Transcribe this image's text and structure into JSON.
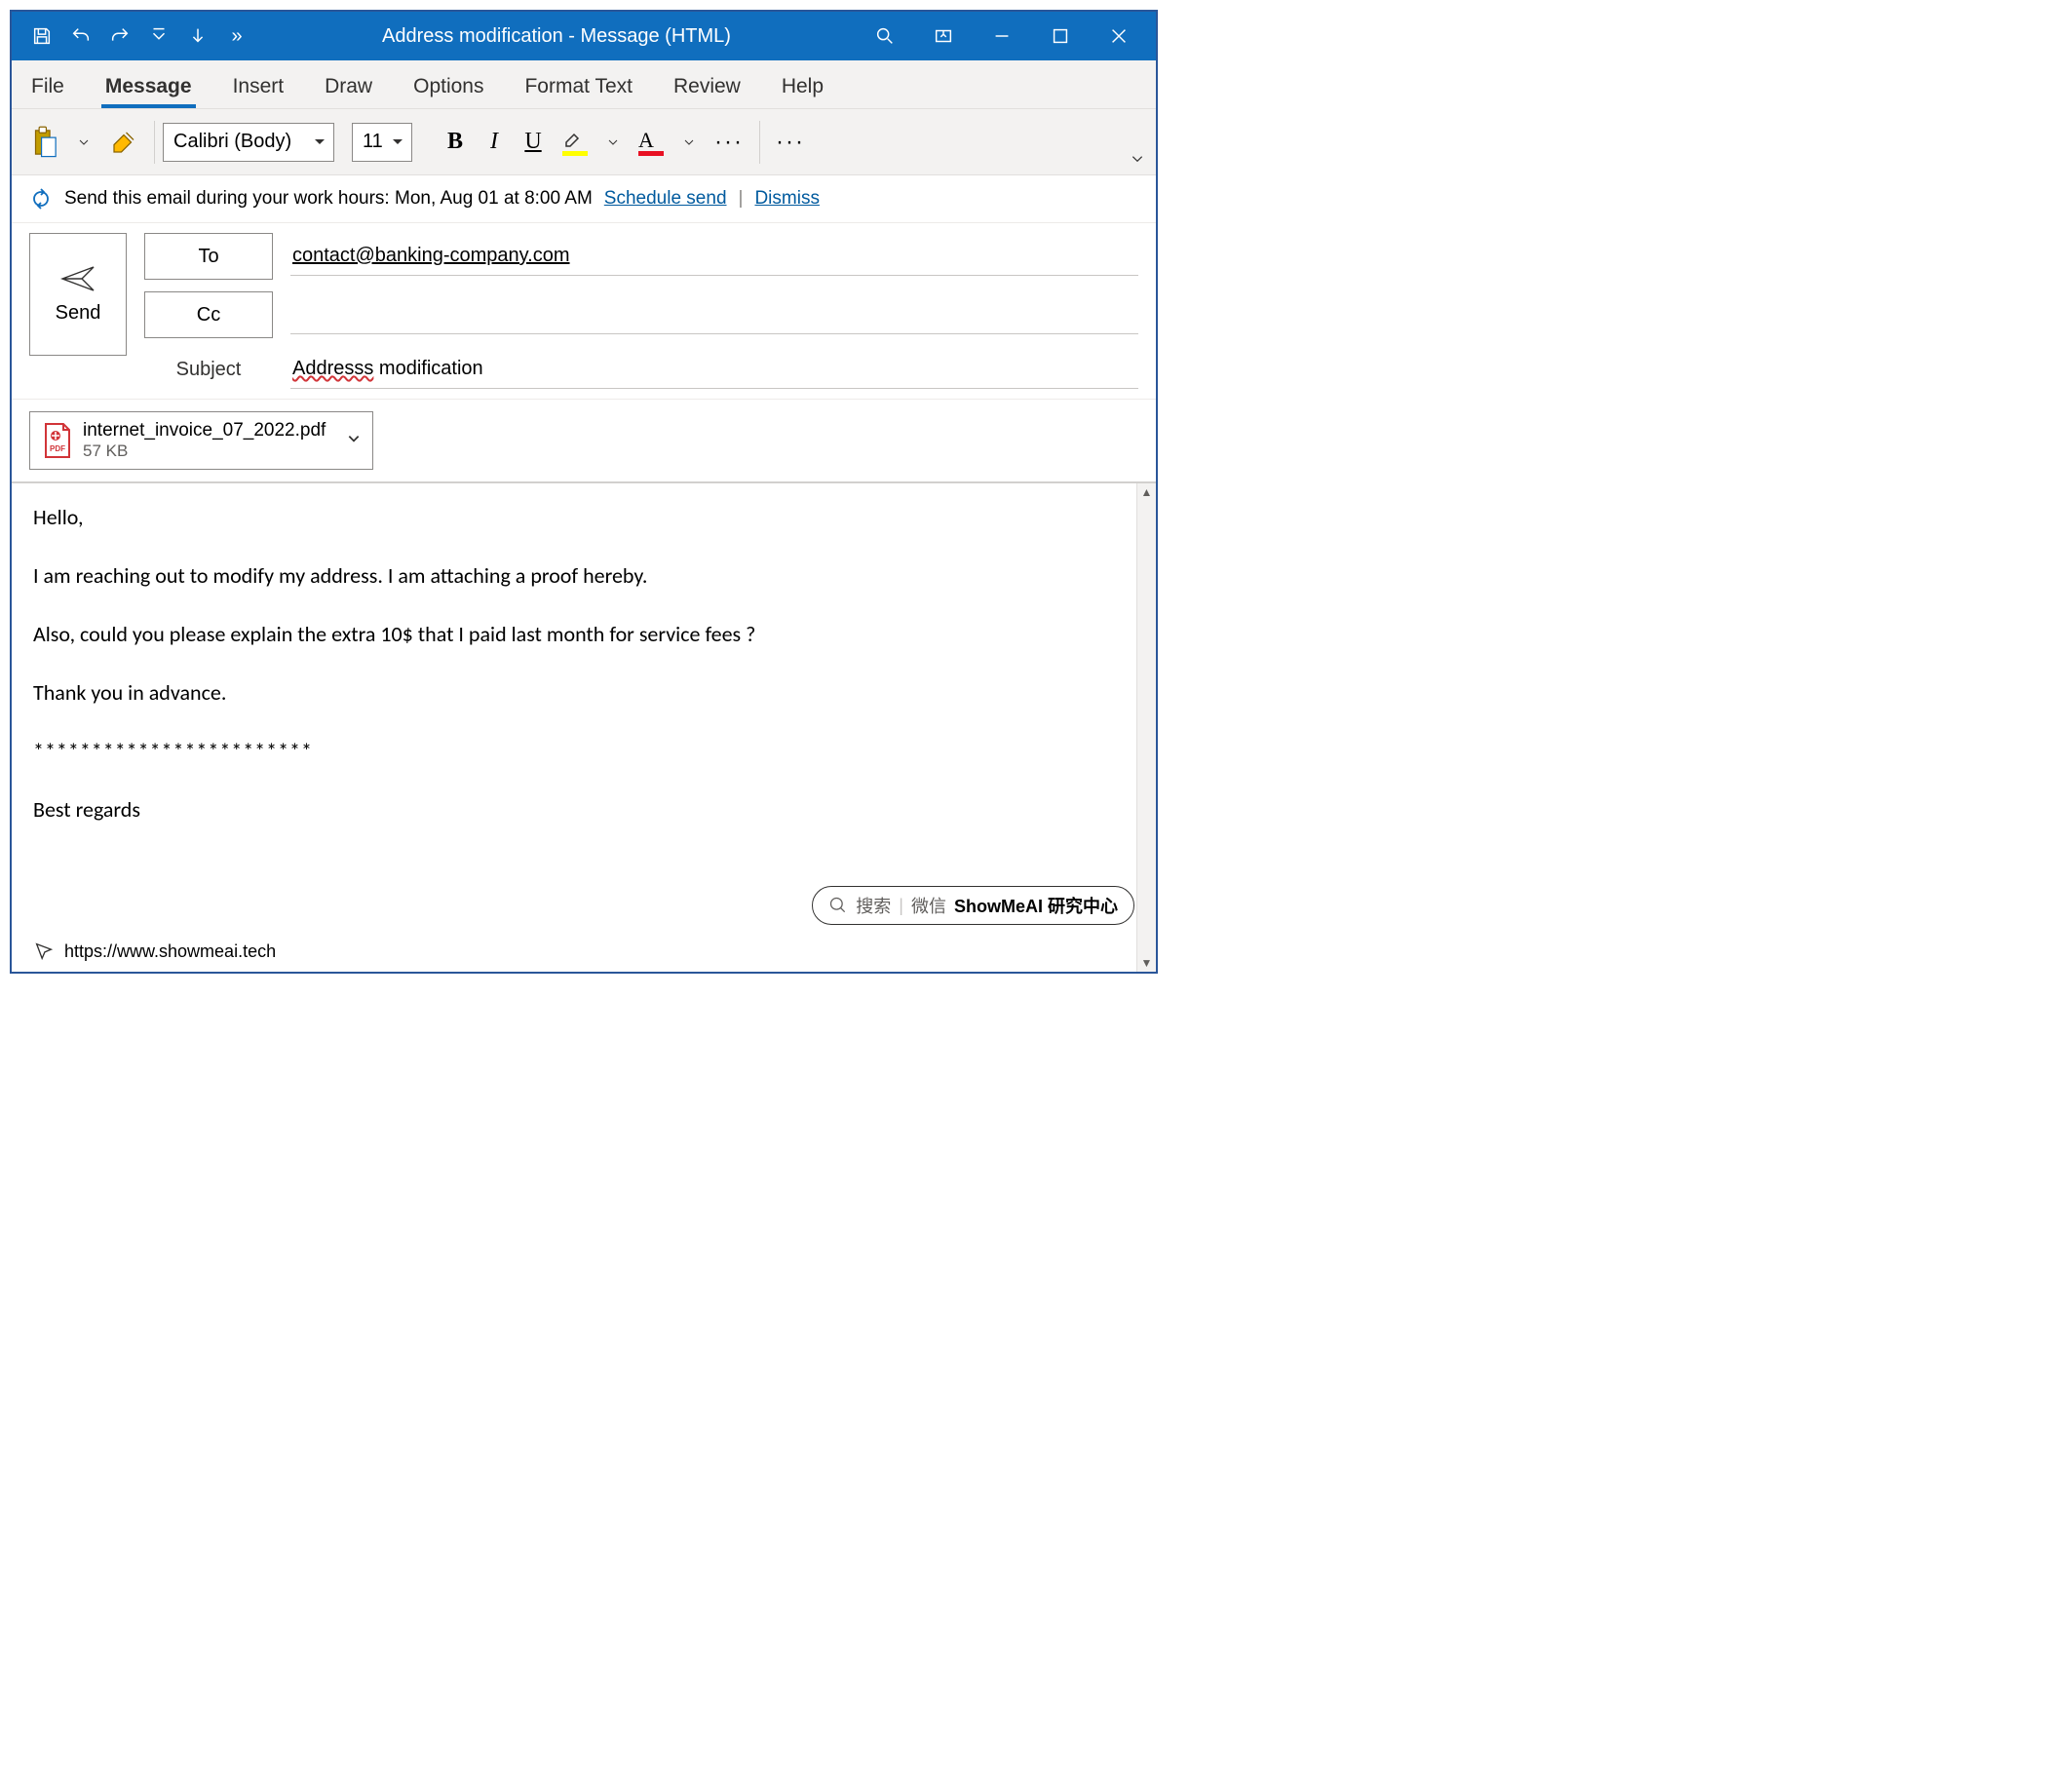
{
  "window": {
    "title": "Address modification  -  Message (HTML)"
  },
  "qat": {
    "overflow": "»"
  },
  "tabs": [
    "File",
    "Message",
    "Insert",
    "Draw",
    "Options",
    "Format Text",
    "Review",
    "Help"
  ],
  "active_tab": "Message",
  "ribbon": {
    "font_name": "Calibri (Body)",
    "font_size": "11",
    "highlight_color": "#ffff00",
    "font_color": "#e81123",
    "bold_glyph": "B",
    "italic_glyph": "I",
    "underline_glyph": "U",
    "highlight_glyph": "",
    "fontcolor_glyph": "A"
  },
  "banner": {
    "text": "Send this email during your work hours: Mon, Aug 01 at 8:00 AM",
    "schedule": "Schedule send",
    "dismiss": "Dismiss"
  },
  "send_label": "Send",
  "fields": {
    "to_label": "To",
    "to_value": "contact@banking-company.com",
    "cc_label": "Cc",
    "cc_value": "",
    "subject_label": "Subject",
    "subject_value_err": "Addresss",
    "subject_value_rest": " modification"
  },
  "attachment": {
    "name": "internet_invoice_07_2022.pdf",
    "size": "57 KB"
  },
  "body": {
    "p1": "Hello,",
    "p2": "I am reaching out to modify my address. I am attaching a proof hereby.",
    "p3": "Also, could you please explain the extra 10$ that I paid last month for service fees ?",
    "p4": "Thank you in advance.",
    "p5": "************************",
    "p6": "Best regards"
  },
  "search_pill": {
    "search": "搜索",
    "wechat": "微信",
    "brand": "ShowMeAI 研究中心"
  },
  "footer_url": "https://www.showmeai.tech"
}
